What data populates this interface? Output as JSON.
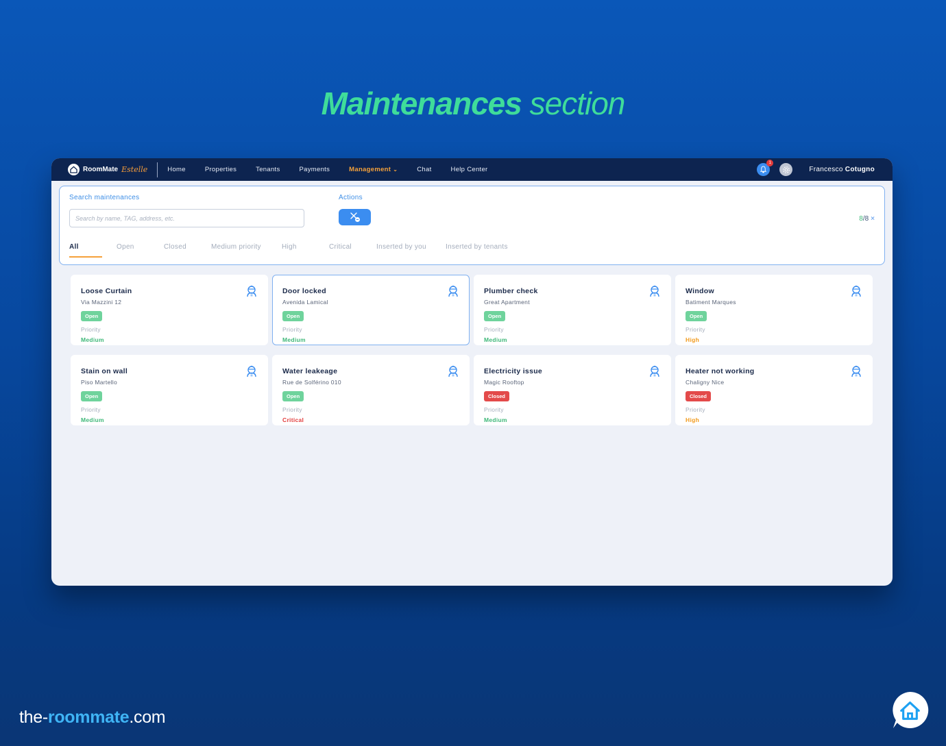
{
  "hero": {
    "bold": "Maintenances",
    "light": "section"
  },
  "topbar": {
    "brand": "RoomMate",
    "brand_sub": "Estelle",
    "nav": [
      {
        "label": "Home"
      },
      {
        "label": "Properties"
      },
      {
        "label": "Tenants"
      },
      {
        "label": "Payments"
      },
      {
        "label": "Management",
        "active": true
      },
      {
        "label": "Chat"
      },
      {
        "label": "Help Center"
      }
    ],
    "notifications": "1",
    "user_first": "Francesco",
    "user_last": "Cotugno"
  },
  "search": {
    "label": "Search maintenances",
    "placeholder": "Search by name, TAG, address, etc.",
    "value": "",
    "actions_label": "Actions"
  },
  "counter": {
    "current": "8",
    "total": "/8",
    "clear": "×"
  },
  "tabs": [
    "All",
    "Open",
    "Closed",
    "Medium priority",
    "High",
    "Critical",
    "Inserted by you",
    "Inserted by tenants"
  ],
  "priority_label": "Priority",
  "cards": [
    {
      "title": "Loose Curtain",
      "address": "Via Mazzini 12",
      "status": "Open",
      "priority": "Medium"
    },
    {
      "title": "Door locked",
      "address": "Avenida Lamical",
      "status": "Open",
      "priority": "Medium"
    },
    {
      "title": "Plumber check",
      "address": "Great Apartment",
      "status": "Open",
      "priority": "Medium"
    },
    {
      "title": "Window",
      "address": "Batiment Marques",
      "status": "Open",
      "priority": "High"
    },
    {
      "title": "Stain on wall",
      "address": "Piso Martello",
      "status": "Open",
      "priority": "Medium"
    },
    {
      "title": "Water leakeage",
      "address": "Rue de Solférino 010",
      "status": "Open",
      "priority": "Critical"
    },
    {
      "title": "Electricity issue",
      "address": "Magic Rooftop",
      "status": "Closed",
      "priority": "Medium"
    },
    {
      "title": "Heater not working",
      "address": "Chaligny Nice",
      "status": "Closed",
      "priority": "High"
    }
  ],
  "colors": {
    "accent": "#3b8df0",
    "open": "#6fd39c",
    "closed": "#e34a4a",
    "medium": "#3fb879",
    "high": "#f29b1d",
    "critical": "#e23c3c",
    "active_nav": "#f5a13a",
    "hero": "#3fdc9a"
  },
  "footer": {
    "prefix": "the-",
    "brand": "roommate",
    "suffix": ".com"
  }
}
